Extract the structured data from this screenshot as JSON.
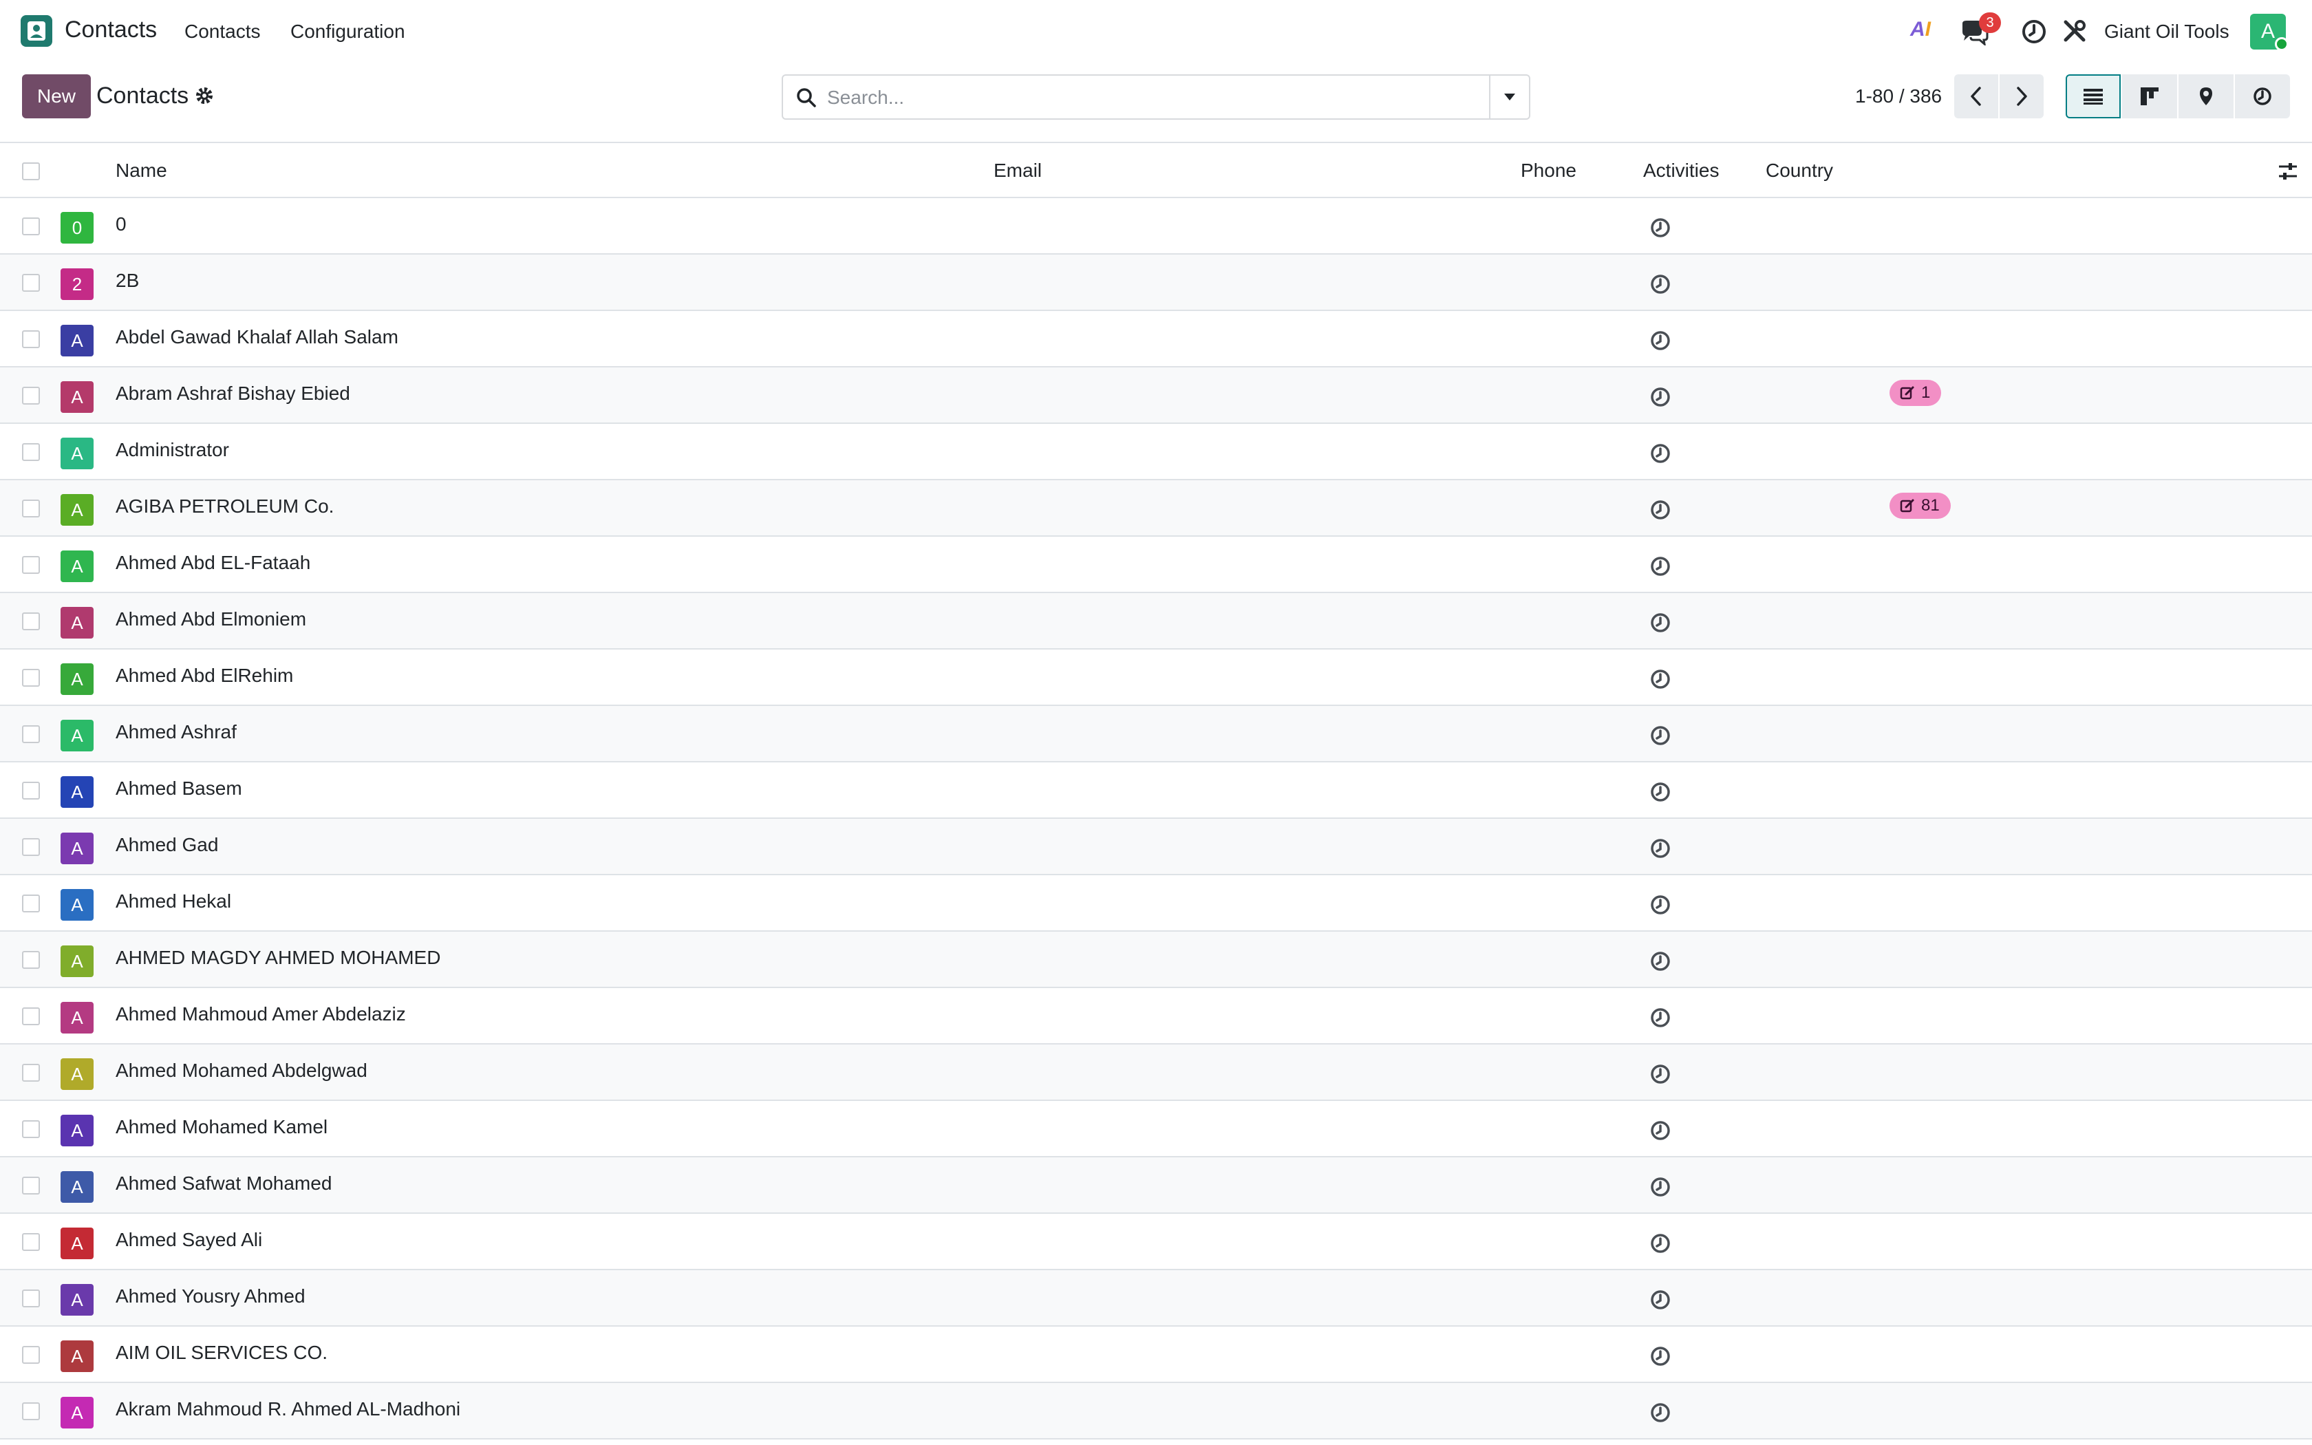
{
  "navbar": {
    "app_title": "Contacts",
    "menus": [
      "Contacts",
      "Configuration"
    ],
    "ai_label": "AI",
    "messages_count": "3",
    "company": "Giant Oil Tools",
    "user_initial": "A",
    "user_color": "#2bb673"
  },
  "control_panel": {
    "new_label": "New",
    "title": "Contacts",
    "search_placeholder": "Search...",
    "pager": "1-80 / 386"
  },
  "table": {
    "headers": {
      "name": "Name",
      "email": "Email",
      "phone": "Phone",
      "activities": "Activities",
      "country": "Country"
    },
    "rows": [
      {
        "initial": "0",
        "color": "#2fb63f",
        "name": "0",
        "badge": null
      },
      {
        "initial": "2",
        "color": "#c42b87",
        "name": "2B",
        "badge": null
      },
      {
        "initial": "A",
        "color": "#3a3ea3",
        "name": "Abdel Gawad Khalaf Allah Salam",
        "badge": null
      },
      {
        "initial": "A",
        "color": "#b43a6a",
        "name": "Abram Ashraf Bishay Ebied",
        "badge": "1"
      },
      {
        "initial": "A",
        "color": "#2ab884",
        "name": "Administrator",
        "badge": null
      },
      {
        "initial": "A",
        "color": "#5aad25",
        "name": "AGIBA PETROLEUM Co.",
        "badge": "81"
      },
      {
        "initial": "A",
        "color": "#2fb64f",
        "name": "Ahmed Abd EL-Fataah",
        "badge": null
      },
      {
        "initial": "A",
        "color": "#b03a6e",
        "name": "Ahmed Abd Elmoniem",
        "badge": null
      },
      {
        "initial": "A",
        "color": "#37a93a",
        "name": "Ahmed Abd ElRehim",
        "badge": null
      },
      {
        "initial": "A",
        "color": "#2bba68",
        "name": "Ahmed Ashraf",
        "badge": null
      },
      {
        "initial": "A",
        "color": "#2444b5",
        "name": "Ahmed Basem",
        "badge": null
      },
      {
        "initial": "A",
        "color": "#7b3ab0",
        "name": "Ahmed Gad",
        "badge": null
      },
      {
        "initial": "A",
        "color": "#2a6ec2",
        "name": "Ahmed Hekal",
        "badge": null
      },
      {
        "initial": "A",
        "color": "#80ad2b",
        "name": "AHMED MAGDY AHMED MOHAMED",
        "badge": null
      },
      {
        "initial": "A",
        "color": "#b43a82",
        "name": "Ahmed Mahmoud Amer Abdelaziz",
        "badge": null
      },
      {
        "initial": "A",
        "color": "#b0aa2a",
        "name": "Ahmed Mohamed Abdelgwad",
        "badge": null
      },
      {
        "initial": "A",
        "color": "#5a34b0",
        "name": "Ahmed Mohamed Kamel",
        "badge": null
      },
      {
        "initial": "A",
        "color": "#3e5aa8",
        "name": "Ahmed Safwat Mohamed",
        "badge": null
      },
      {
        "initial": "A",
        "color": "#c42a34",
        "name": "Ahmed Sayed Ali",
        "badge": null
      },
      {
        "initial": "A",
        "color": "#6a3aab",
        "name": "Ahmed Yousry Ahmed",
        "badge": null
      },
      {
        "initial": "A",
        "color": "#ad3a3e",
        "name": "AIM OIL SERVICES CO.",
        "badge": null
      },
      {
        "initial": "A",
        "color": "#c42ab3",
        "name": "Akram Mahmoud R. Ahmed AL-Madhoni",
        "badge": null
      }
    ]
  },
  "colors": {
    "primary": "#714b67",
    "accent": "#017e84",
    "badge_bg": "#f28fc5"
  }
}
